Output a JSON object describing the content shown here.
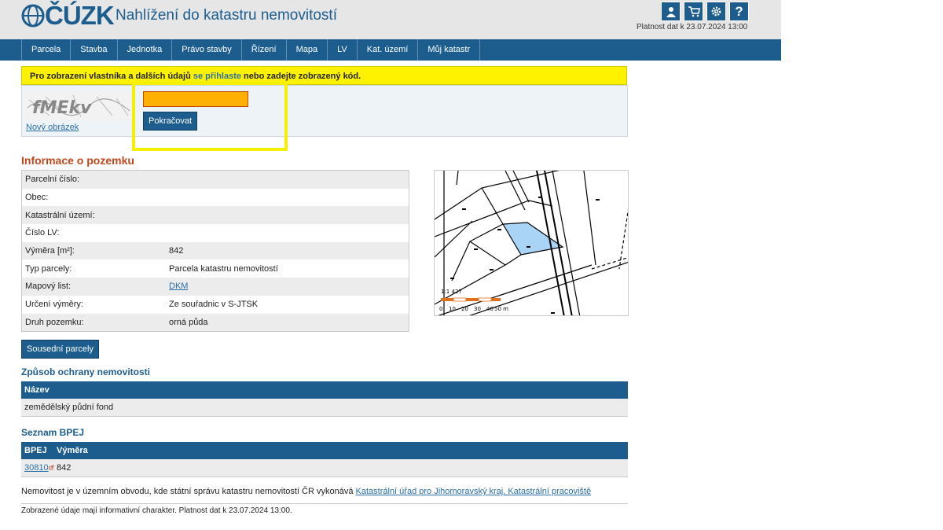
{
  "header": {
    "logo_text": "ČÚZK",
    "app_title": "Nahlížení do katastru nemovitostí",
    "validity": "Platnost dat k 23.07.2024 13:00",
    "icons": [
      "user-icon",
      "cart-icon",
      "gear-icon",
      "help-icon"
    ]
  },
  "nav": {
    "items": [
      "Parcela",
      "Stavba",
      "Jednotka",
      "Právo stavby",
      "Řízení",
      "Mapa",
      "LV",
      "Kat. území",
      "Můj katastr"
    ]
  },
  "notice": {
    "text_before": "Pro zobrazení vlastníka a dalších údajů ",
    "link": "se přihlaste",
    "text_after": " nebo zadejte zobrazený kód."
  },
  "captcha": {
    "new_image": "Nový obrázek",
    "input_value": "",
    "continue": "Pokračovat"
  },
  "parcel_info": {
    "title": "Informace o pozemku",
    "rows": [
      {
        "label": "Parcelní číslo:",
        "value": ""
      },
      {
        "label": "Obec:",
        "value": ""
      },
      {
        "label": "Katastrální území:",
        "value": ""
      },
      {
        "label": "Číslo LV:",
        "value": ""
      },
      {
        "label": "Výměra [m²]:",
        "value": "842"
      },
      {
        "label": "Typ parcely:",
        "value": "Parcela katastru nemovitostí"
      },
      {
        "label": "Mapový list:",
        "value": "DKM"
      },
      {
        "label": "Určení výměry:",
        "value": "Ze souřadnic v S-JTSK"
      },
      {
        "label": "Druh pozemku:",
        "value": "orná půda"
      }
    ]
  },
  "map": {
    "scale_label": "1:1 427",
    "scale_ticks": [
      "0",
      "10",
      "20",
      "30",
      "40",
      "50 m"
    ]
  },
  "neighbors_button": "Sousední parcely",
  "protection": {
    "title": "Způsob ochrany nemovitosti",
    "header": "Název",
    "value": "zemědělský půdní fond"
  },
  "bpej": {
    "title": "Seznam BPEJ",
    "headers": [
      "BPEJ",
      "Výměra"
    ],
    "row": {
      "code": "30810",
      "area": "842"
    }
  },
  "footer": {
    "text": "Nemovitost je v územním obvodu, kde státní správu katastru nemovitostí ČR vykonává ",
    "link": "Katastrální úřad pro Jihomoravský kraj, Katastrální pracoviště",
    "note": "Zobrazené údaje mají informativní charakter. Platnost dat k 23.07.2024 13:00."
  }
}
